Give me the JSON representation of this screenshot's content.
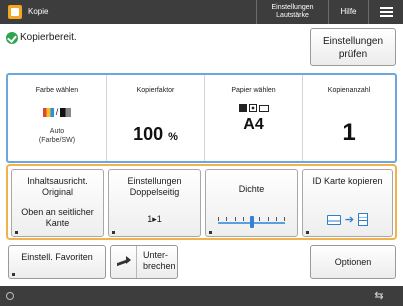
{
  "top_bar": {
    "app_title": "Kopie",
    "settings_label": "Einstellungen Lautstärke",
    "help_label": "Hilfe",
    "app_icon": "copy-app-icon",
    "menu_icon": "hamburger-menu-icon"
  },
  "status": {
    "icon": "check-circle-icon",
    "text": "Kopierbereit.",
    "check_settings_label": "Einstellungen prüfen"
  },
  "summary": {
    "color": {
      "label": "Farbe wählen",
      "value": "Auto (Farbe/SW)"
    },
    "ratio": {
      "label": "Kopierfaktor",
      "value": "100",
      "unit": "%"
    },
    "paper": {
      "label": "Papier wählen",
      "value": "A4"
    },
    "copies": {
      "label": "Kopienanzahl",
      "value": "1"
    }
  },
  "functions": {
    "orientation": {
      "title": "Inhaltsausricht. Original",
      "value": "Oben an seitlicher Kante"
    },
    "duplex": {
      "title": "Einstellungen Doppelseitig",
      "value": "1▸1"
    },
    "density": {
      "title": "Dichte",
      "level": 0.5
    },
    "id_card": {
      "title": "ID Karte kopieren"
    }
  },
  "bottom_buttons": {
    "favorites_label": "Einstell. Favoriten",
    "interrupt_label": "Unter- brechen",
    "options_label": "Optionen"
  },
  "colors": {
    "summary_border": "#6aa6e2",
    "functions_border": "#f0b34a",
    "status_ok": "#2ea44f",
    "bar_bg": "#3d3d3d"
  }
}
